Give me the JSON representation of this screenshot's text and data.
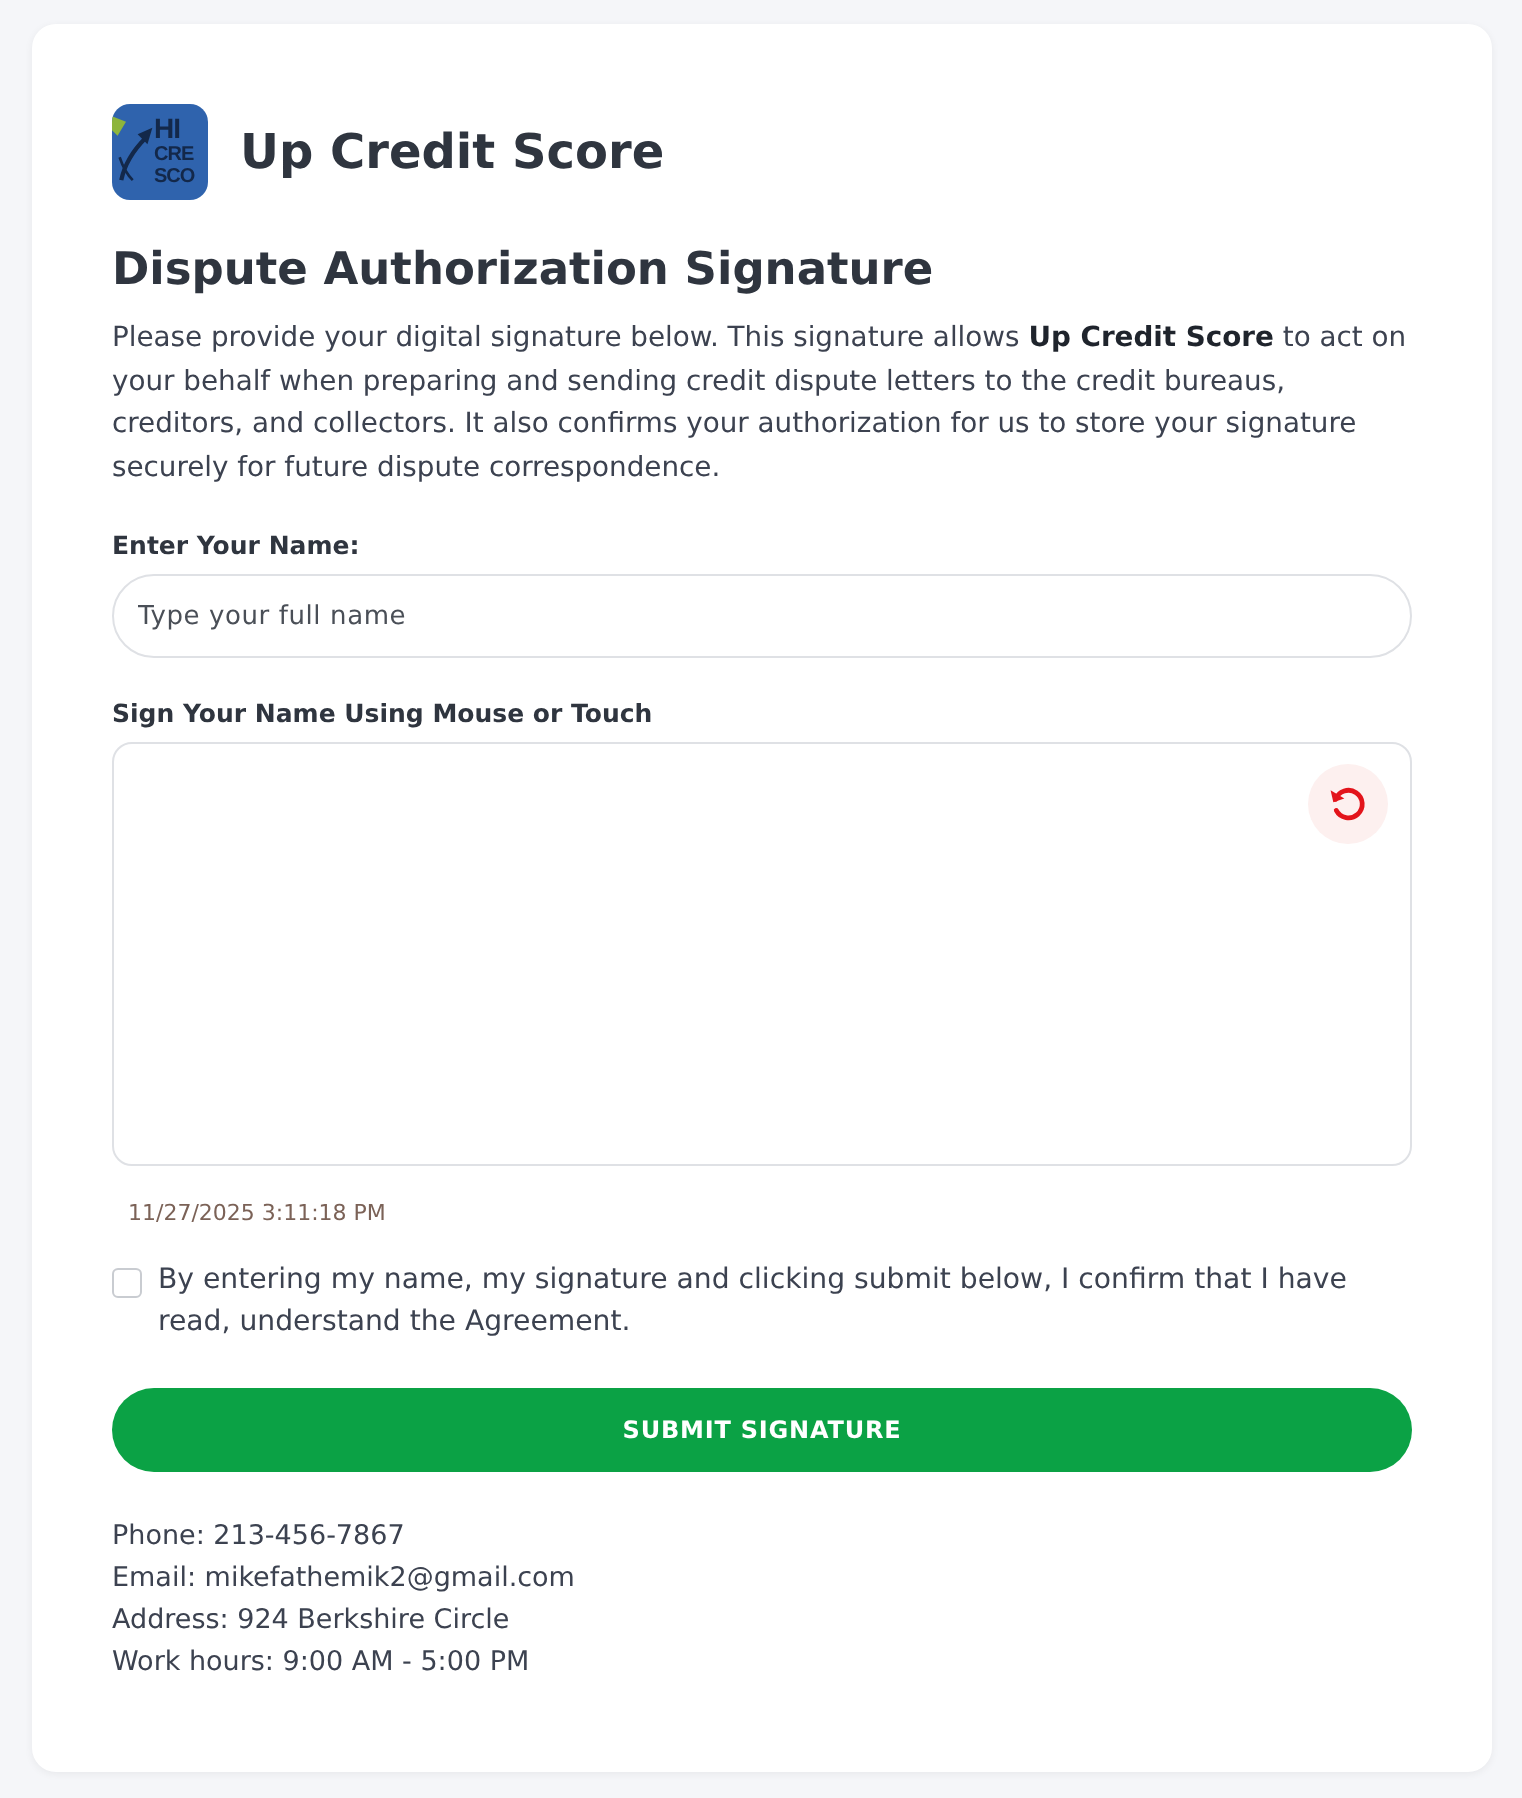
{
  "brand": {
    "logo_text": [
      "HI",
      "CRE",
      "SCO"
    ],
    "name": "Up Credit Score"
  },
  "heading": "Dispute Authorization Signature",
  "intro": "Please provide your digital signature below. This signature allows **Up Credit Score** to act on your behalf when preparing and sending credit dispute letters to the credit bureaus, creditors, and collectors. It also confirms your authorization for us to store your signature securely for future dispute correspondence.",
  "name_field": {
    "label": "Enter Your Name:",
    "placeholder": "Type your full name"
  },
  "signature_pad": {
    "label": "Sign Your Name Using Mouse or Touch",
    "timestamp": "11/27/2025 3:11:18 PM"
  },
  "agreement": {
    "checked": false,
    "text": "By entering my name, my signature and clicking submit below, I confirm that I have read, understand the Agreement."
  },
  "submit_button": {
    "label": "SUBMIT SIGNATURE"
  },
  "contact": [
    "Phone: 213-456-7867",
    "Email: mikefathemik2@gmail.com",
    "Address: 924 Berkshire Circle",
    "Work hours: 9:00 AM - 5:00 PM"
  ]
}
